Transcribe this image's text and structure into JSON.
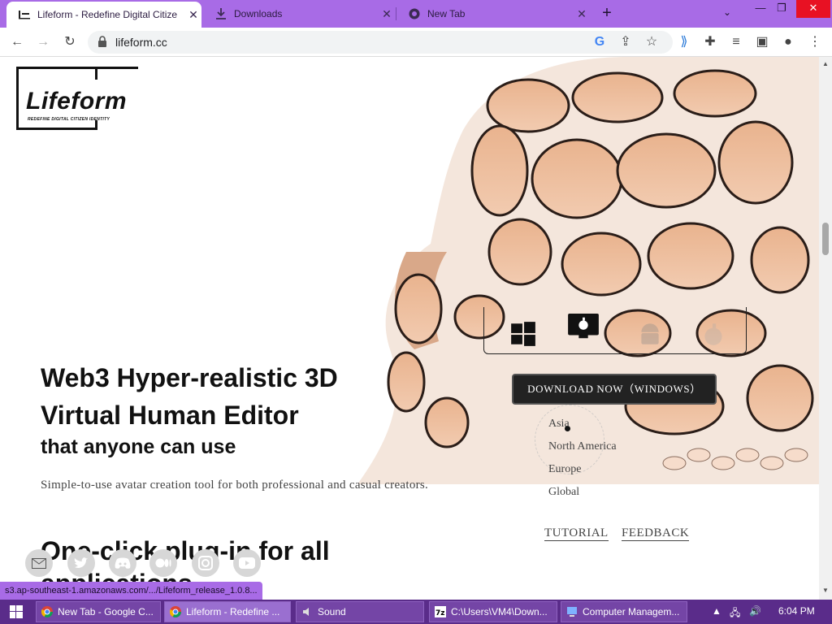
{
  "tabs": [
    {
      "title": "Lifeform - Redefine Digital Citize",
      "active": true,
      "icon": "lifeform-favicon"
    },
    {
      "title": "Downloads",
      "active": false,
      "icon": "download-icon"
    },
    {
      "title": "New Tab",
      "active": false,
      "icon": "chrome-icon"
    }
  ],
  "address_bar": {
    "url": "lifeform.cc"
  },
  "logo": {
    "name": "Lifeform",
    "tagline": "REDEFINE DIGITAL CITIZEN IDENTITY"
  },
  "hero": {
    "headline_line1": "Web3 Hyper-realistic 3D",
    "headline_line2": "Virtual Human Editor",
    "subheadline": "that anyone can use",
    "description": "Simple-to-use avatar creation tool for both professional and casual creators."
  },
  "platforms": [
    "windows",
    "apple",
    "android",
    "ios"
  ],
  "download_button": "DOWNLOAD NOW（WINDOWS）",
  "regions": [
    "Asia",
    "North America",
    "Europe",
    "Global"
  ],
  "links": {
    "tutorial": "TUTORIAL",
    "feedback": "FEEDBACK"
  },
  "section2": {
    "line1": "One-click plug-in for all",
    "line2": "applications"
  },
  "social_icons": [
    "email-icon",
    "twitter-icon",
    "discord-icon",
    "medium-icon",
    "instagram-icon",
    "youtube-icon"
  ],
  "status_bar": {
    "url": "s3.ap-southeast-1.amazonaws.com/.../Lifeform_release_1.0.8..."
  },
  "taskbar": {
    "tasks": [
      {
        "label": "New Tab - Google C...",
        "icon": "chrome-icon"
      },
      {
        "label": "Lifeform - Redefine ...",
        "icon": "chrome-icon",
        "active": true
      },
      {
        "label": "Sound",
        "icon": "sound-icon"
      },
      {
        "label": "C:\\Users\\VM4\\Down...",
        "icon": "7zip-icon"
      },
      {
        "label": "Computer Managem...",
        "icon": "computer-management-icon"
      }
    ],
    "clock": "6:04 PM"
  },
  "colors": {
    "tabstrip": "#a86be6",
    "taskbar": "#5a2c8a",
    "button": "#222222"
  }
}
